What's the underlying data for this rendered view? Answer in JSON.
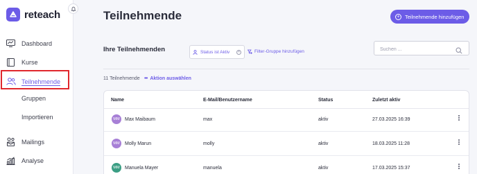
{
  "brand": {
    "name": "reteach"
  },
  "sidebar": {
    "items": [
      {
        "label": "Dashboard",
        "icon": "dashboard-icon"
      },
      {
        "label": "Kurse",
        "icon": "book-icon"
      },
      {
        "label": "Teilnehmende",
        "icon": "users-icon",
        "active": true
      },
      {
        "label": "Gruppen"
      },
      {
        "label": "Importieren"
      },
      {
        "label": "Mailings",
        "icon": "mailings-icon"
      },
      {
        "label": "Analyse",
        "icon": "analytics-icon"
      }
    ]
  },
  "header": {
    "title": "Teilnehmende",
    "add_button": "Teilnehmende hinzufügen"
  },
  "filters": {
    "section_title": "Ihre Teilnehmenden",
    "chip_label": "Status ist Aktiv",
    "add_filter_group": "Filter-Gruppe hinzufügen",
    "search_placeholder": "Suchen ..."
  },
  "list": {
    "count": "11 Teilnehmende",
    "select_action": "Aktion auswählen"
  },
  "table": {
    "columns": [
      "Name",
      "E-Mail/Benutzername",
      "Status",
      "Zuletzt aktiv"
    ],
    "rows": [
      {
        "initials": "MM",
        "name": "Max Maibaum",
        "email": "max",
        "status": "aktiv",
        "last_active": "27.03.2025 16:39",
        "avatar_color": "#a77fd6"
      },
      {
        "initials": "MM",
        "name": "Molly Marun",
        "email": "molly",
        "status": "aktiv",
        "last_active": "18.03.2025 11:28",
        "avatar_color": "#a77fd6"
      },
      {
        "initials": "MM",
        "name": "Manuela Mayer",
        "email": "manuela",
        "status": "aktiv",
        "last_active": "17.03.2025 15:37",
        "avatar_color": "#3b9e84"
      }
    ]
  },
  "colors": {
    "accent": "#6c5ce7",
    "highlight": "#e0262c"
  }
}
